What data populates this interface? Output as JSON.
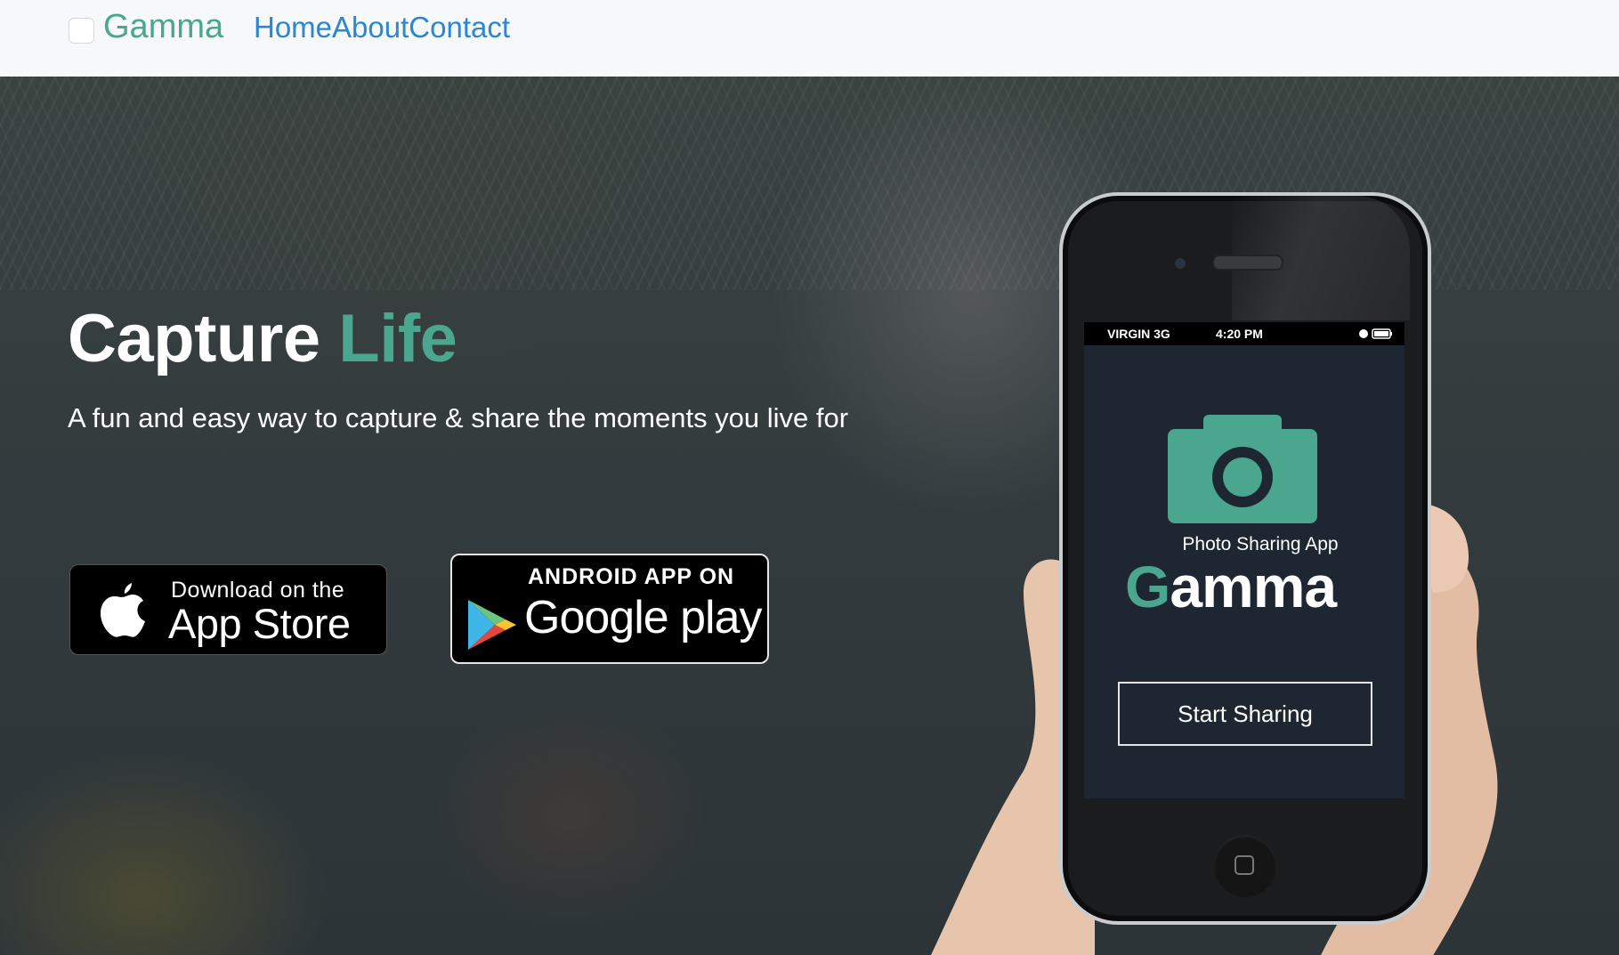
{
  "navbar": {
    "brand": "Gamma",
    "links": [
      "Home",
      "About",
      "Contact"
    ]
  },
  "hero": {
    "headline_main": "Capture",
    "headline_accent": "Life",
    "subline": "A fun and easy way to capture & share the moments you live for"
  },
  "badges": {
    "apple": {
      "small": "Download on the",
      "big": "App Store",
      "icon": "apple-icon"
    },
    "google": {
      "small": "ANDROID APP ON",
      "big": "Google play",
      "icon": "google-play-icon"
    }
  },
  "phone": {
    "status_carrier": "VIRGIN  3G",
    "status_time": "4:20 PM",
    "app_subtitle": "Photo Sharing App",
    "app_logo_first": "G",
    "app_logo_rest": "amma",
    "start_button": "Start Sharing",
    "camera_icon": "camera-icon"
  },
  "colors": {
    "accent": "#4aa68f",
    "link": "#2b86d6",
    "navbar_bg": "#f7f8fa"
  }
}
